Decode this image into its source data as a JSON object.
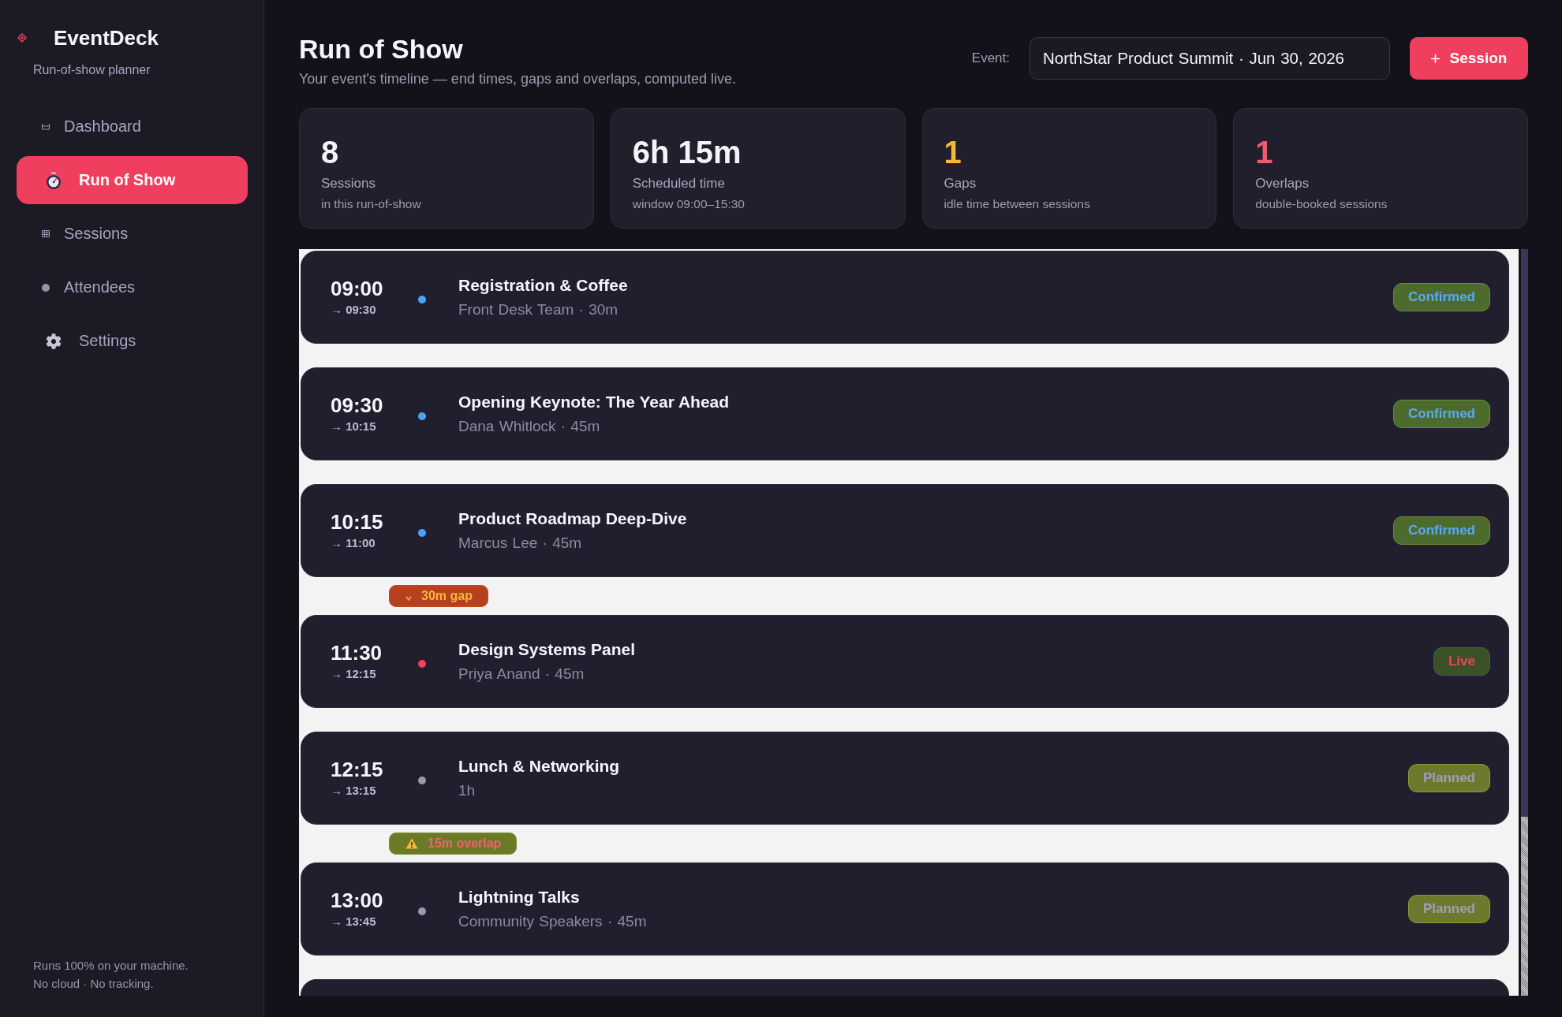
{
  "sidebar": {
    "brand": "EventDeck",
    "tagline": "Run-of-show planner",
    "nav": [
      {
        "label": "Dashboard",
        "selected": false
      },
      {
        "label": "Run of Show",
        "selected": true
      },
      {
        "label": "Sessions",
        "selected": false
      },
      {
        "label": "Attendees",
        "selected": false
      },
      {
        "label": "Settings",
        "selected": false
      }
    ],
    "footer": [
      "Runs 100% on your machine.",
      "No cloud · No tracking."
    ]
  },
  "header": {
    "title": "Run of Show",
    "subtitle": "Your event's timeline — end times, gaps and overlaps, computed live.",
    "event_label": "Event:",
    "event_value": "NorthStar Product Summit · Jun 30, 2026",
    "add_button": "Session"
  },
  "stats": [
    {
      "value": "8",
      "label": "Sessions",
      "note": "in this run-of-show",
      "color": "#f4f2fb"
    },
    {
      "value": "6h 15m",
      "label": "Scheduled time",
      "note": "window 09:00–15:30",
      "color": "#f4f2fb"
    },
    {
      "value": "1",
      "label": "Gaps",
      "note": "idle time between sessions",
      "color": "#f5b73a"
    },
    {
      "value": "1",
      "label": "Overlaps",
      "note": "double-booked sessions",
      "color": "#ee5a70"
    }
  ],
  "timeline": {
    "items": [
      {
        "kind": "session",
        "start": "09:00",
        "end": "→ 09:30",
        "title": "Registration & Coffee",
        "meta": "Front Desk Team · 30m",
        "color": "#4aa3f7",
        "status": {
          "label": "Confirmed",
          "kind": "confirmed"
        }
      },
      {
        "kind": "session",
        "start": "09:30",
        "end": "→ 10:15",
        "title": "Opening Keynote: The Year Ahead",
        "meta": "Dana Whitlock · 45m",
        "color": "#4aa3f7",
        "status": {
          "label": "Confirmed",
          "kind": "confirmed"
        }
      },
      {
        "kind": "session",
        "start": "10:15",
        "end": "→ 11:00",
        "title": "Product Roadmap Deep-Dive",
        "meta": "Marcus Lee · 45m",
        "color": "#4aa3f7",
        "status": {
          "label": "Confirmed",
          "kind": "confirmed"
        }
      },
      {
        "kind": "gap",
        "label": "30m gap"
      },
      {
        "kind": "session",
        "start": "11:30",
        "end": "→ 12:15",
        "title": "Design Systems Panel",
        "meta": "Priya Anand · 45m",
        "color": "#f43f5e",
        "status": {
          "label": "Live",
          "kind": "live"
        }
      },
      {
        "kind": "session",
        "start": "12:15",
        "end": "→ 13:15",
        "title": "Lunch & Networking",
        "meta": "1h",
        "color": "#9c98ab",
        "status": {
          "label": "Planned",
          "kind": "planned"
        }
      },
      {
        "kind": "overlap",
        "label": "15m overlap"
      },
      {
        "kind": "session",
        "start": "13:00",
        "end": "→ 13:45",
        "title": "Lightning Talks",
        "meta": "Community Speakers · 45m",
        "color": "#9c98ab",
        "status": {
          "label": "Planned",
          "kind": "planned"
        }
      }
    ],
    "more_below": true
  }
}
